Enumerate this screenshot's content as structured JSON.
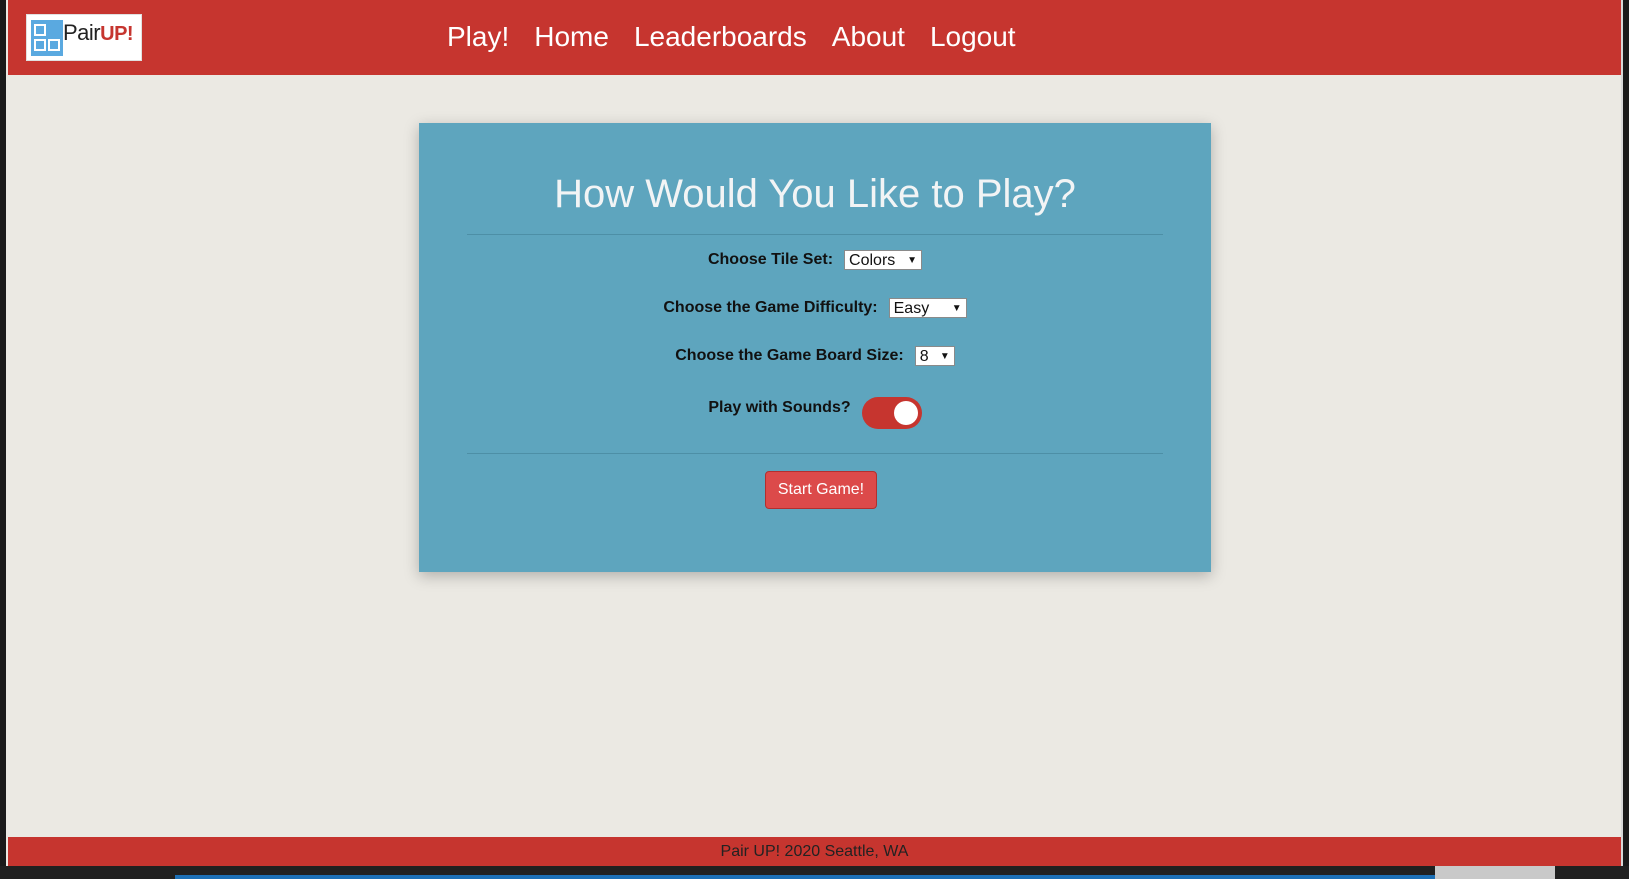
{
  "brand": {
    "logo_text": "Pair",
    "logo_accent": "UP!",
    "primary_color": "#c6352f",
    "panel_color": "#5ea5be",
    "background_color": "#ebe9e3"
  },
  "nav": {
    "items": [
      {
        "label": "Play!"
      },
      {
        "label": "Home"
      },
      {
        "label": "Leaderboards"
      },
      {
        "label": "About"
      },
      {
        "label": "Logout"
      }
    ]
  },
  "settings": {
    "title": "How Would You Like to Play?",
    "tile_set": {
      "label": "Choose Tile Set:",
      "value": "Colors"
    },
    "difficulty": {
      "label": "Choose the Game Difficulty:",
      "value": "Easy"
    },
    "board_size": {
      "label": "Choose the Game Board Size:",
      "value": "8"
    },
    "sounds": {
      "label": "Play with Sounds?",
      "enabled": true
    },
    "start_label": "Start Game!"
  },
  "footer": {
    "text": "Pair UP! 2020 Seattle, WA"
  },
  "icons": {
    "logo": "tile-grid-icon",
    "select_arrow": "triangle-down-icon"
  }
}
